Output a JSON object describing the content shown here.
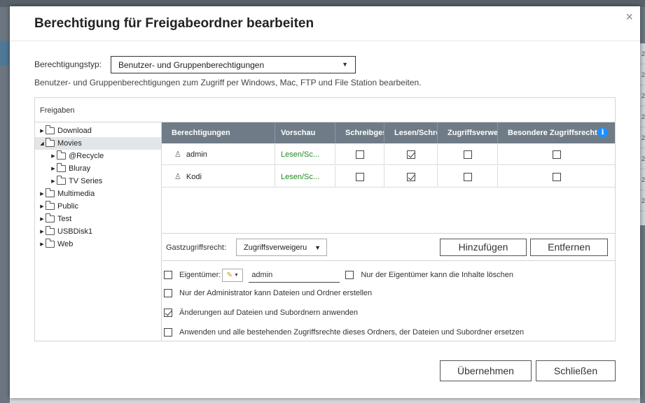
{
  "dialog": {
    "title": "Berechtigung für Freigabeordner bearbeiten",
    "close_glyph": "×",
    "permission_type_label": "Berechtigungstyp:",
    "permission_type_value": "Benutzer- und Gruppenberechtigungen",
    "description": "Benutzer- und Gruppenberechtigungen zum Zugriff per Windows, Mac, FTP und File Station bearbeiten.",
    "shares_label": "Freigaben"
  },
  "tree": [
    {
      "label": "Download",
      "expanded": false,
      "selected": false,
      "level": 0
    },
    {
      "label": "Movies",
      "expanded": true,
      "selected": true,
      "level": 0
    },
    {
      "label": "@Recycle",
      "expanded": false,
      "selected": false,
      "level": 1
    },
    {
      "label": "Bluray",
      "expanded": false,
      "selected": false,
      "level": 1
    },
    {
      "label": "TV Series",
      "expanded": false,
      "selected": false,
      "level": 1
    },
    {
      "label": "Multimedia",
      "expanded": false,
      "selected": false,
      "level": 0
    },
    {
      "label": "Public",
      "expanded": false,
      "selected": false,
      "level": 0
    },
    {
      "label": "Test",
      "expanded": false,
      "selected": false,
      "level": 0
    },
    {
      "label": "USBDisk1",
      "expanded": false,
      "selected": false,
      "level": 0
    },
    {
      "label": "Web",
      "expanded": false,
      "selected": false,
      "level": 0
    }
  ],
  "grid": {
    "columns": [
      "Berechtigungen",
      "Vorschau",
      "Schreibges",
      "Lesen/Schre",
      "Zugriffsverwei",
      "Besondere Zugriffsrechte"
    ],
    "info_glyph": "i",
    "rows": [
      {
        "name": "admin",
        "preview": "Lesen/Sc...",
        "read_only": false,
        "read_write": true,
        "deny": false,
        "special": false
      },
      {
        "name": "Kodi",
        "preview": "Lesen/Sc...",
        "read_only": false,
        "read_write": true,
        "deny": false,
        "special": false
      }
    ]
  },
  "guest": {
    "label": "Gastzugriffsrecht:",
    "value": "Zugriffsverweigeru"
  },
  "buttons": {
    "add": "Hinzufügen",
    "remove": "Entfernen",
    "apply": "Übernehmen",
    "close": "Schließen"
  },
  "options": {
    "owner_label": "Eigentümer:",
    "owner_value": "admin",
    "only_owner_delete": "Nur der Eigentümer kann die Inhalte löschen",
    "only_admin_create": "Nur der Administrator kann Dateien und Ordner erstellen",
    "apply_to_subfolders": "Änderungen auf Dateien und Subordnern anwenden",
    "replace_all": "Anwenden und alle bestehenden Zugriffsrechte dieses Ordners, der Dateien und Subordner ersetzen",
    "checked": {
      "owner": false,
      "only_owner_delete": false,
      "only_admin_create": false,
      "apply_to_subfolders": true,
      "replace_all": false
    }
  },
  "background": {
    "side_numbers": [
      "2",
      "2",
      "2",
      "2",
      "2",
      "2",
      "2",
      "2"
    ]
  },
  "colors": {
    "grid_header": "#6f7c87",
    "preview_text": "#1f8a1f",
    "info_icon": "#1e90ff"
  }
}
